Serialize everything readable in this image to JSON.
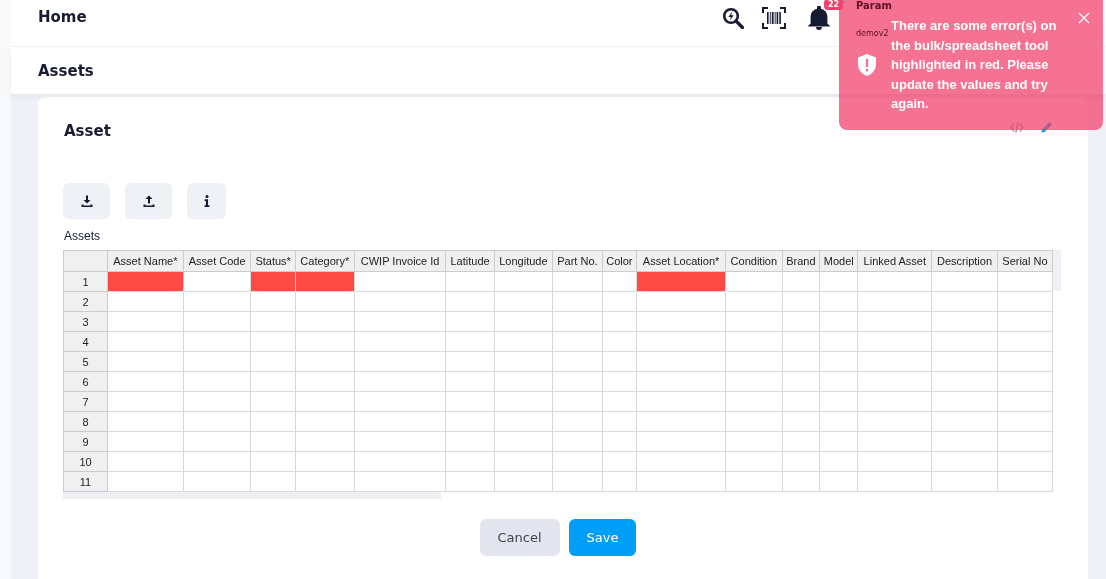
{
  "header": {
    "title": "Home",
    "notification_count": "22",
    "user": {
      "name": "Param",
      "account": "demov2"
    }
  },
  "section": {
    "title": "Assets"
  },
  "card": {
    "title": "Asset"
  },
  "grid": {
    "label": "Assets",
    "columns": [
      "Asset Name*",
      "Asset Code",
      "Status*",
      "Category*",
      "CWIP Invoice Id",
      "Latitude",
      "Longitude",
      "Part No.",
      "Color",
      "Asset Location*",
      "Condition",
      "Brand",
      "Model",
      "Linked Asset",
      "Description",
      "Serial No"
    ],
    "rows": [
      {
        "number": "1",
        "cells": [
          {
            "error": true
          },
          {
            "error": false
          },
          {
            "error": true
          },
          {
            "error": true
          },
          {
            "error": false
          },
          {
            "error": false
          },
          {
            "error": false
          },
          {
            "error": false
          },
          {
            "error": false
          },
          {
            "error": true
          },
          {
            "error": false
          },
          {
            "error": false
          },
          {
            "error": false
          },
          {
            "error": false
          },
          {
            "error": false
          },
          {
            "error": false
          }
        ]
      },
      {
        "number": "2",
        "cells": [
          {
            "error": false
          },
          {
            "error": false
          },
          {
            "error": false
          },
          {
            "error": false
          },
          {
            "error": false
          },
          {
            "error": false
          },
          {
            "error": false
          },
          {
            "error": false
          },
          {
            "error": false
          },
          {
            "error": false
          },
          {
            "error": false
          },
          {
            "error": false
          },
          {
            "error": false
          },
          {
            "error": false
          },
          {
            "error": false
          },
          {
            "error": false
          }
        ]
      },
      {
        "number": "3",
        "cells": [
          {
            "error": false
          },
          {
            "error": false
          },
          {
            "error": false
          },
          {
            "error": false
          },
          {
            "error": false
          },
          {
            "error": false
          },
          {
            "error": false
          },
          {
            "error": false
          },
          {
            "error": false
          },
          {
            "error": false
          },
          {
            "error": false
          },
          {
            "error": false
          },
          {
            "error": false
          },
          {
            "error": false
          },
          {
            "error": false
          },
          {
            "error": false
          }
        ]
      },
      {
        "number": "4",
        "cells": [
          {
            "error": false
          },
          {
            "error": false
          },
          {
            "error": false
          },
          {
            "error": false
          },
          {
            "error": false
          },
          {
            "error": false
          },
          {
            "error": false
          },
          {
            "error": false
          },
          {
            "error": false
          },
          {
            "error": false
          },
          {
            "error": false
          },
          {
            "error": false
          },
          {
            "error": false
          },
          {
            "error": false
          },
          {
            "error": false
          },
          {
            "error": false
          }
        ]
      },
      {
        "number": "5",
        "cells": [
          {
            "error": false
          },
          {
            "error": false
          },
          {
            "error": false
          },
          {
            "error": false
          },
          {
            "error": false
          },
          {
            "error": false
          },
          {
            "error": false
          },
          {
            "error": false
          },
          {
            "error": false
          },
          {
            "error": false
          },
          {
            "error": false
          },
          {
            "error": false
          },
          {
            "error": false
          },
          {
            "error": false
          },
          {
            "error": false
          },
          {
            "error": false
          }
        ]
      },
      {
        "number": "6",
        "cells": [
          {
            "error": false
          },
          {
            "error": false
          },
          {
            "error": false
          },
          {
            "error": false
          },
          {
            "error": false
          },
          {
            "error": false
          },
          {
            "error": false
          },
          {
            "error": false
          },
          {
            "error": false
          },
          {
            "error": false
          },
          {
            "error": false
          },
          {
            "error": false
          },
          {
            "error": false
          },
          {
            "error": false
          },
          {
            "error": false
          },
          {
            "error": false
          }
        ]
      },
      {
        "number": "7",
        "cells": [
          {
            "error": false
          },
          {
            "error": false
          },
          {
            "error": false
          },
          {
            "error": false
          },
          {
            "error": false
          },
          {
            "error": false
          },
          {
            "error": false
          },
          {
            "error": false
          },
          {
            "error": false
          },
          {
            "error": false
          },
          {
            "error": false
          },
          {
            "error": false
          },
          {
            "error": false
          },
          {
            "error": false
          },
          {
            "error": false
          },
          {
            "error": false
          }
        ]
      },
      {
        "number": "8",
        "cells": [
          {
            "error": false
          },
          {
            "error": false
          },
          {
            "error": false
          },
          {
            "error": false
          },
          {
            "error": false
          },
          {
            "error": false
          },
          {
            "error": false
          },
          {
            "error": false
          },
          {
            "error": false
          },
          {
            "error": false
          },
          {
            "error": false
          },
          {
            "error": false
          },
          {
            "error": false
          },
          {
            "error": false
          },
          {
            "error": false
          },
          {
            "error": false
          }
        ]
      },
      {
        "number": "9",
        "cells": [
          {
            "error": false
          },
          {
            "error": false
          },
          {
            "error": false
          },
          {
            "error": false
          },
          {
            "error": false
          },
          {
            "error": false
          },
          {
            "error": false
          },
          {
            "error": false
          },
          {
            "error": false
          },
          {
            "error": false
          },
          {
            "error": false
          },
          {
            "error": false
          },
          {
            "error": false
          },
          {
            "error": false
          },
          {
            "error": false
          },
          {
            "error": false
          }
        ]
      },
      {
        "number": "10",
        "cells": [
          {
            "error": false
          },
          {
            "error": false
          },
          {
            "error": false
          },
          {
            "error": false
          },
          {
            "error": false
          },
          {
            "error": false
          },
          {
            "error": false
          },
          {
            "error": false
          },
          {
            "error": false
          },
          {
            "error": false
          },
          {
            "error": false
          },
          {
            "error": false
          },
          {
            "error": false
          },
          {
            "error": false
          },
          {
            "error": false
          },
          {
            "error": false
          }
        ]
      },
      {
        "number": "11",
        "cells": [
          {
            "error": false
          },
          {
            "error": false
          },
          {
            "error": false
          },
          {
            "error": false
          },
          {
            "error": false
          },
          {
            "error": false
          },
          {
            "error": false
          },
          {
            "error": false
          },
          {
            "error": false
          },
          {
            "error": false
          },
          {
            "error": false
          },
          {
            "error": false
          },
          {
            "error": false
          },
          {
            "error": false
          },
          {
            "error": false
          },
          {
            "error": false
          }
        ]
      }
    ]
  },
  "actions": [
    {
      "label": "Cancel",
      "kind": "secondary"
    },
    {
      "label": "Save",
      "kind": "primary"
    }
  ],
  "toast": {
    "message": "There are some error(s) on the bulk/spreadsheet tool highlighted in red. Please update the values and try again."
  }
}
